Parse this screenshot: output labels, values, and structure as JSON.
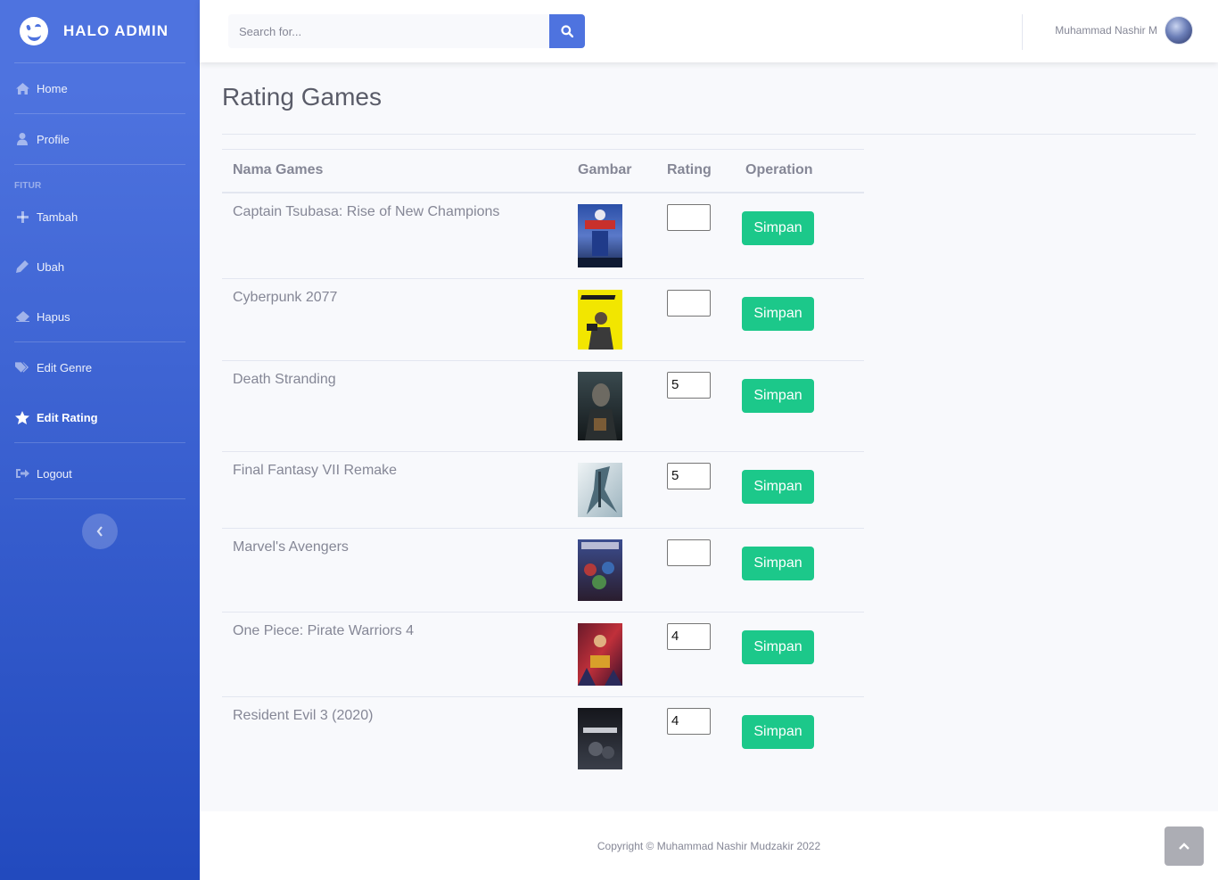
{
  "brand": {
    "title": "HALO ADMIN"
  },
  "sidebar": {
    "items": [
      {
        "label": "Home",
        "icon": "home-icon"
      },
      {
        "label": "Profile",
        "icon": "user-icon"
      },
      {
        "label": "Tambah",
        "icon": "plus-icon"
      },
      {
        "label": "Ubah",
        "icon": "pencil-icon"
      },
      {
        "label": "Hapus",
        "icon": "eraser-icon"
      },
      {
        "label": "Edit Genre",
        "icon": "tags-icon"
      },
      {
        "label": "Edit Rating",
        "icon": "star-icon",
        "active": true
      },
      {
        "label": "Logout",
        "icon": "sign-out-icon"
      }
    ],
    "heading": "FITUR"
  },
  "search": {
    "placeholder": "Search for..."
  },
  "user": {
    "name": "Muhammad Nashir M"
  },
  "page": {
    "title": "Rating Games"
  },
  "table": {
    "headers": [
      "Nama Games",
      "Gambar",
      "Rating",
      "Operation"
    ],
    "button_label": "Simpan",
    "rows": [
      {
        "name": "Captain Tsubasa: Rise of New Champions",
        "rating": ""
      },
      {
        "name": "Cyberpunk 2077",
        "rating": ""
      },
      {
        "name": "Death Stranding",
        "rating": "5"
      },
      {
        "name": "Final Fantasy VII Remake",
        "rating": "5"
      },
      {
        "name": "Marvel's Avengers",
        "rating": ""
      },
      {
        "name": "One Piece: Pirate Warriors 4",
        "rating": "4"
      },
      {
        "name": "Resident Evil 3 (2020)",
        "rating": "4"
      }
    ]
  },
  "footer": {
    "copyright": "Copyright © Muhammad Nashir Mudzakir 2022"
  },
  "colors": {
    "primary": "#4e73df",
    "success": "#1cc88a"
  }
}
